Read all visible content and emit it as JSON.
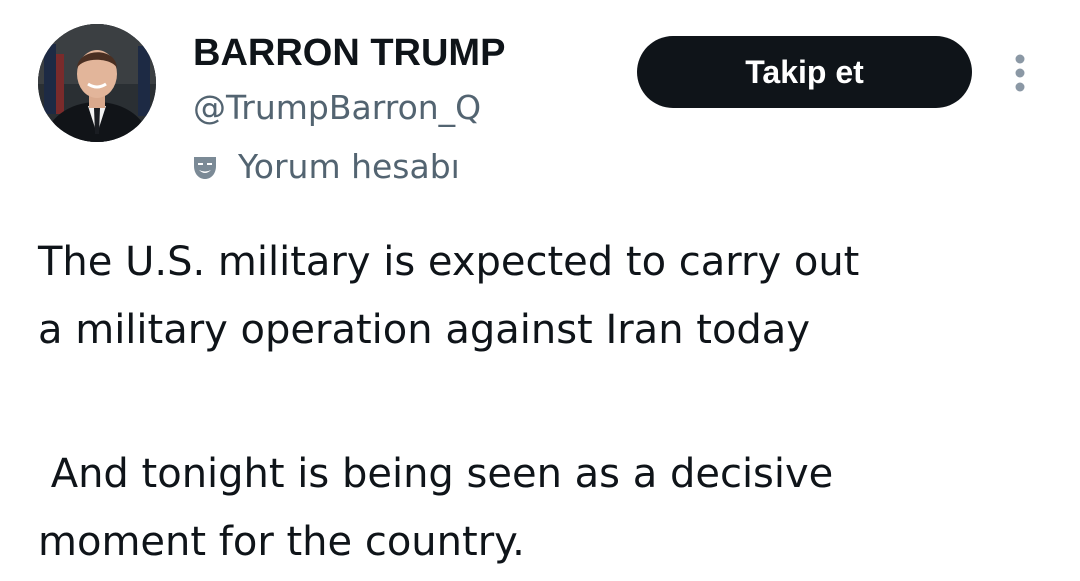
{
  "author": {
    "display_name": "BARRON TRUMP",
    "handle": "@TrumpBarron_Q",
    "account_label": "Yorum hesabı",
    "avatar_icon": "profile-photo",
    "label_icon": "theater-mask-icon"
  },
  "actions": {
    "follow_label": "Takip et",
    "more_icon": "vertical-ellipsis-icon"
  },
  "tweet": {
    "paragraph1": {
      "line1": "The U.S. military is expected to carry out",
      "line2": "a military operation against Iran today"
    },
    "paragraph2": {
      "line1": " And tonight is being seen as a decisive",
      "line2": "moment for the country."
    }
  },
  "colors": {
    "text_primary": "#0f1419",
    "text_secondary": "#536471",
    "button_bg": "#0f1419",
    "button_text": "#ffffff"
  }
}
